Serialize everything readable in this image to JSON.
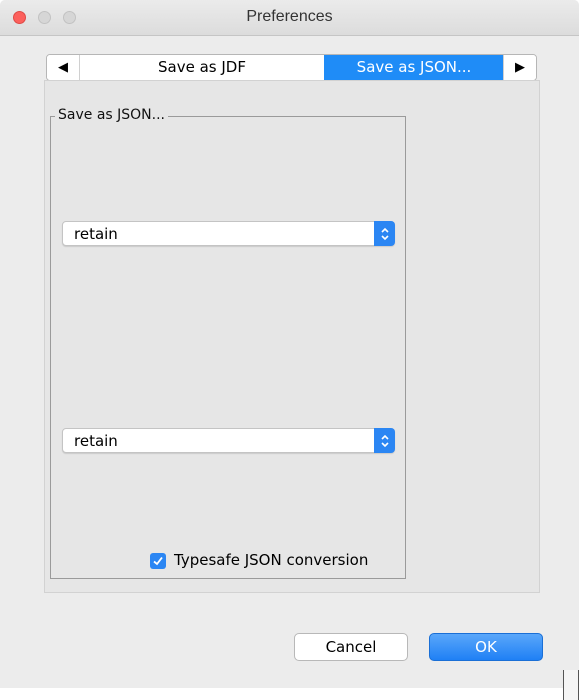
{
  "window": {
    "title": "Preferences"
  },
  "tabs": {
    "prev_arrow": "◀",
    "next_arrow": "▶",
    "items": [
      {
        "label": "Save as JDF",
        "selected": false
      },
      {
        "label": "Save as JSON...",
        "selected": true
      }
    ]
  },
  "group": {
    "title": "Save as JSON...",
    "combo1": {
      "value": "retain"
    },
    "combo2": {
      "value": "retain"
    },
    "typesafe": {
      "label": "Typesafe JSON conversion",
      "checked": true
    }
  },
  "buttons": {
    "cancel": "Cancel",
    "ok": "OK"
  },
  "colors": {
    "accent": "#1f8cf7",
    "close": "#fc605c"
  },
  "icons": {
    "combo_arrow": "updown-chevron-icon",
    "check": "checkmark-icon"
  }
}
